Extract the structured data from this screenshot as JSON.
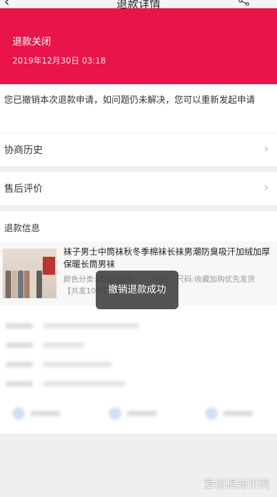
{
  "navbar": {
    "title": "退款详情"
  },
  "status": {
    "title": "退款关闭",
    "time": "2019年12月30日 03:18",
    "color": "#e8144a"
  },
  "notice": {
    "text": "您已撤销本次退款申请，如问题仍未解决，您可以重新发起申请"
  },
  "rows": [
    {
      "label": "协商历史"
    },
    {
      "label": "售后评价"
    }
  ],
  "refund": {
    "heading": "退款信息",
    "product": {
      "title": "袜子男士中筒袜秋冬季棉袜长袜男潮防臭吸汗加绒加厚保暖长筒男袜",
      "spec": "颜色分类:精梳棉组合一（10双）;尺码:收藏加购优先发货",
      "qty": "【共发10双】"
    }
  },
  "toast": {
    "text": "撤销退款成功"
  },
  "watermark": {
    "text": "爱创根知识网"
  }
}
